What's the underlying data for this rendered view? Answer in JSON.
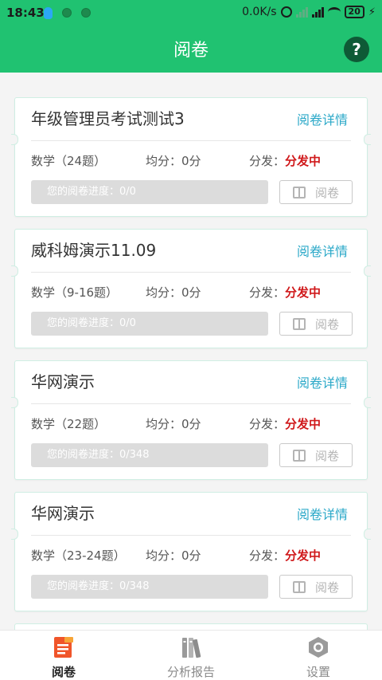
{
  "status_bar": {
    "time": "18:43",
    "speed": "0.0K/s",
    "battery": "20"
  },
  "header": {
    "title": "阅卷",
    "help_label": "?"
  },
  "cards": [
    {
      "title": "年级管理员考试测试3",
      "detail_link": "阅卷详情",
      "subject": "数学（24题）",
      "average": "均分：0分",
      "dist_label": "分发：",
      "dist_status": "分发中",
      "progress": "您的阅卷进度：0/0",
      "grade_button": "阅卷"
    },
    {
      "title": "威科姆演示11.09",
      "detail_link": "阅卷详情",
      "subject": "数学（9-16题）",
      "average": "均分：0分",
      "dist_label": "分发：",
      "dist_status": "分发中",
      "progress": "您的阅卷进度：0/0",
      "grade_button": "阅卷"
    },
    {
      "title": "华网演示",
      "detail_link": "阅卷详情",
      "subject": "数学（22题）",
      "average": "均分：0分",
      "dist_label": "分发：",
      "dist_status": "分发中",
      "progress": "您的阅卷进度：0/348",
      "grade_button": "阅卷"
    },
    {
      "title": "华网演示",
      "detail_link": "阅卷详情",
      "subject": "数学（23-24题）",
      "average": "均分：0分",
      "dist_label": "分发：",
      "dist_status": "分发中",
      "progress": "您的阅卷进度：0/348",
      "grade_button": "阅卷"
    }
  ],
  "bottom_nav": [
    {
      "label": "阅卷",
      "icon": "grading-doc-icon",
      "active": true
    },
    {
      "label": "分析报告",
      "icon": "books-report-icon",
      "active": false
    },
    {
      "label": "设置",
      "icon": "hexagon-gear-icon",
      "active": false
    }
  ],
  "colors": {
    "brand": "#20c271",
    "link": "#2aa8c8",
    "status_red": "#d0191b"
  }
}
